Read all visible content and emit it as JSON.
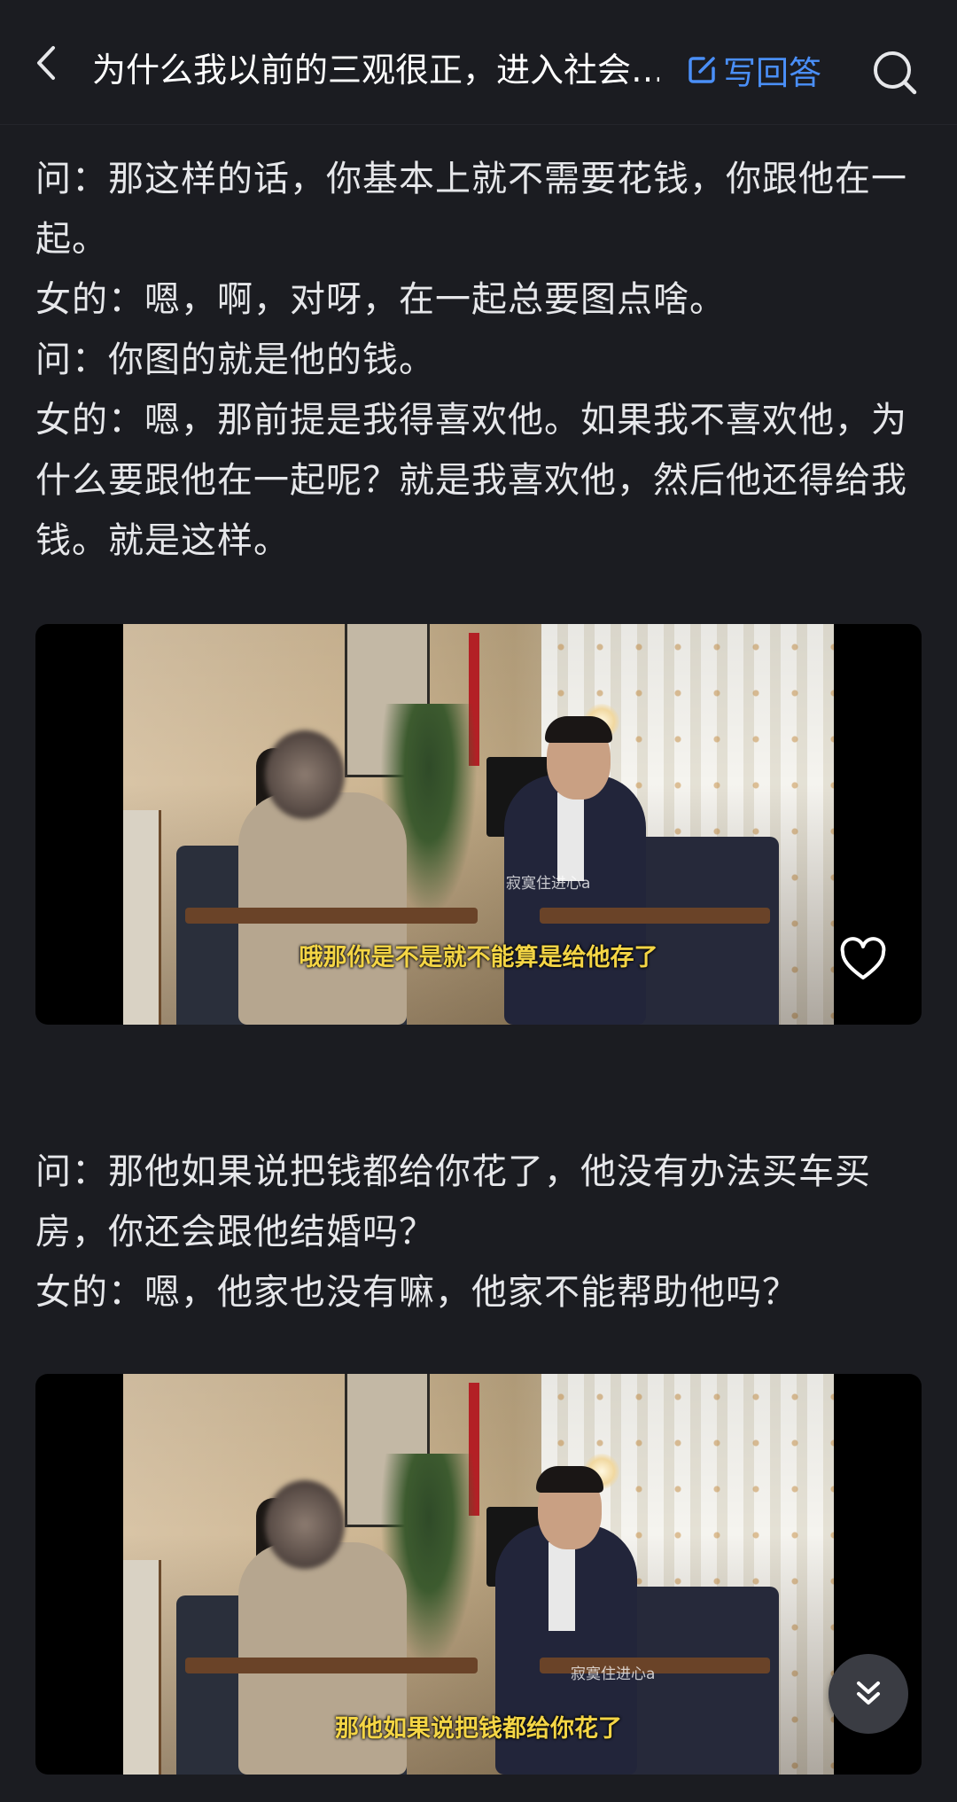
{
  "header": {
    "title": "为什么我以前的三观很正，进入社会…",
    "write_label": "写回答",
    "back_icon": "chevron-left-icon",
    "search_icon": "search-icon",
    "accent": "#4a8ff8"
  },
  "content": {
    "paragraph1": [
      "问：那这样的话，你基本上就不需要花钱，你跟他在一起。",
      "女的：嗯，啊，对呀，在一起总要图点啥。",
      "问：你图的就是他的钱。",
      "女的：嗯，那前提是我得喜欢他。如果我不喜欢他，为什么要跟他在一起呢？就是我喜欢他，然后他还得给我钱。就是这样。"
    ],
    "video1": {
      "subtitle": "哦那你是不是就不能算是给他存了",
      "watermark": "寂寞住进心a"
    },
    "paragraph2": [
      "问：那他如果说把钱都给你花了，他没有办法买车买房，你还会跟他结婚吗？",
      "女的：嗯，他家也没有嘛，他家不能帮助他吗？"
    ],
    "video2": {
      "subtitle": "那他如果说把钱都给你花了",
      "watermark": "寂寞住进心a"
    }
  },
  "fab": {
    "icon": "double-chevron-down-icon"
  }
}
